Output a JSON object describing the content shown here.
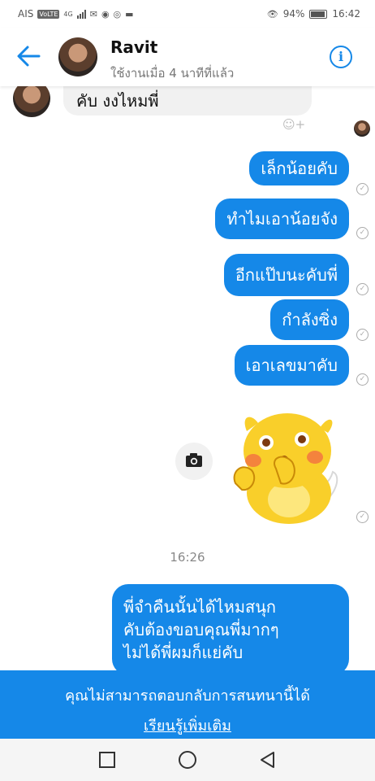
{
  "statusbar": {
    "carrier": "AIS",
    "volte": "VoLTE",
    "network": "4G",
    "battery": "94%",
    "time": "16:42"
  },
  "header": {
    "name": "Ravit",
    "status": "ใช้งานเมื่อ 4 นาทีที่แล้ว",
    "info_glyph": "i"
  },
  "incoming_partial": {
    "text": "คับ งงไหมพี่"
  },
  "outgoing": [
    {
      "text": "เล็กน้อยคับ"
    },
    {
      "text": "ทำไมเอาน้อยจัง"
    },
    {
      "text": "อีกแป๊บนะคับพี่"
    },
    {
      "text": "กำลังซิ่ง"
    },
    {
      "text": "เอาเลขมาคับ"
    }
  ],
  "timestamp": "16:26",
  "last_message": {
    "line1": "พี่จำคืนนั้นได้ไหมสนุก",
    "line2": "คับต้องขอบคุณพี่มากๆ",
    "line3": "ไม่ได้พี่ผมก็แย่คับ"
  },
  "banner": {
    "text": "คุณไม่สามารถตอบกลับการสนทนานี้ได้",
    "link": "เรียนรู้เพิ่มเติม"
  },
  "colors": {
    "accent": "#1588e8",
    "incoming_bubble": "#f1f1f1",
    "sticker_yellow": "#f9cf2a"
  }
}
